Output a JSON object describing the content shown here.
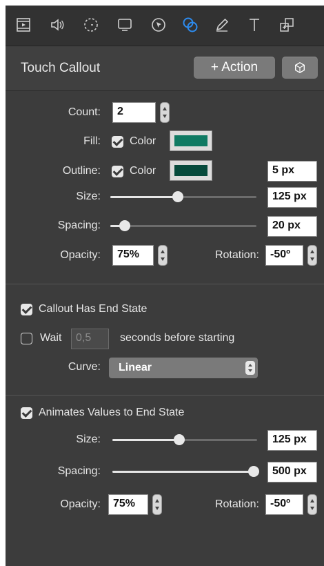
{
  "toolbar": {
    "icons": [
      "film-icon",
      "speaker-icon",
      "timer-icon",
      "screen-icon",
      "cursor-icon",
      "callout-icon",
      "pen-icon",
      "text-icon",
      "layers-icon"
    ],
    "active_icon": "callout-icon"
  },
  "header": {
    "title": "Touch Callout",
    "action_label": "+ Action",
    "cube_icon": "cube-icon"
  },
  "appearance": {
    "count_label": "Count:",
    "count_value": "2",
    "fill_label": "Fill:",
    "fill_checked": true,
    "fill_color_label": "Color",
    "fill_color": "#0f7a63",
    "outline_label": "Outline:",
    "outline_checked": true,
    "outline_color_label": "Color",
    "outline_color": "#064a3c",
    "outline_width": "5 px",
    "size_label": "Size:",
    "size_value": "125 px",
    "size_fraction": 0.46,
    "spacing_label": "Spacing:",
    "spacing_value": "20 px",
    "spacing_fraction": 0.1,
    "opacity_label": "Opacity:",
    "opacity_value": "75%",
    "rotation_label": "Rotation:",
    "rotation_value": "-50º"
  },
  "end_state": {
    "has_end_state_checked": true,
    "has_end_state_label": "Callout Has End State",
    "wait_checked": false,
    "wait_label": "Wait",
    "wait_value": "0,5",
    "wait_suffix": "seconds before starting",
    "curve_label": "Curve:",
    "curve_value": "Linear"
  },
  "animates": {
    "animates_checked": true,
    "animates_label": "Animates Values to End State",
    "size_label": "Size:",
    "size_value": "125 px",
    "size_fraction": 0.46,
    "spacing_label": "Spacing:",
    "spacing_value": "500 px",
    "spacing_fraction": 1.0,
    "opacity_label": "Opacity:",
    "opacity_value": "75%",
    "rotation_label": "Rotation:",
    "rotation_value": "-50º"
  },
  "colors": {
    "accent": "#2d8cf0",
    "panel": "#3c3c3c"
  }
}
